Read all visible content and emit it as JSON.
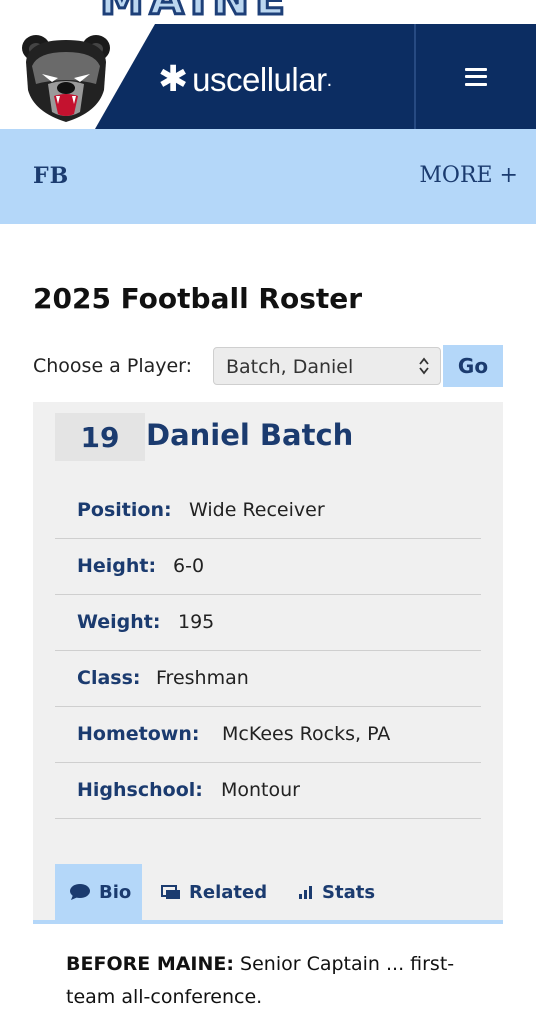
{
  "top_banner": {
    "wordmark": "MAINE"
  },
  "header": {
    "sponsor": {
      "star": "✱",
      "brand": "uscellular",
      "mark": "."
    }
  },
  "subnav": {
    "sport": "FB",
    "more": "MORE +"
  },
  "page": {
    "title": "2025 Football Roster"
  },
  "chooser": {
    "label": "Choose a Player:",
    "selected": "Batch, Daniel",
    "go_label": "Go"
  },
  "player": {
    "number": "19",
    "name": "Daniel Batch",
    "facts": [
      {
        "key": "Position:",
        "value": "Wide Receiver"
      },
      {
        "key": "Height:",
        "value": "6-0"
      },
      {
        "key": "Weight:",
        "value": "195"
      },
      {
        "key": "Class:",
        "value": "Freshman"
      },
      {
        "key": "Hometown:",
        "value": "McKees Rocks, PA"
      },
      {
        "key": "Highschool:",
        "value": "Montour"
      }
    ]
  },
  "tabs": [
    {
      "label": "Bio",
      "icon": "speech-bubble-icon",
      "active": true
    },
    {
      "label": "Related",
      "icon": "cards-icon",
      "active": false
    },
    {
      "label": "Stats",
      "icon": "bar-chart-icon",
      "active": false
    }
  ],
  "bio": {
    "lead": "BEFORE MAINE:",
    "text": " Senior Captain ... first-team all-conference."
  },
  "colors": {
    "navy": "#0c2d62",
    "accent": "#b4d7f9",
    "text_blue": "#1b3b6f"
  }
}
